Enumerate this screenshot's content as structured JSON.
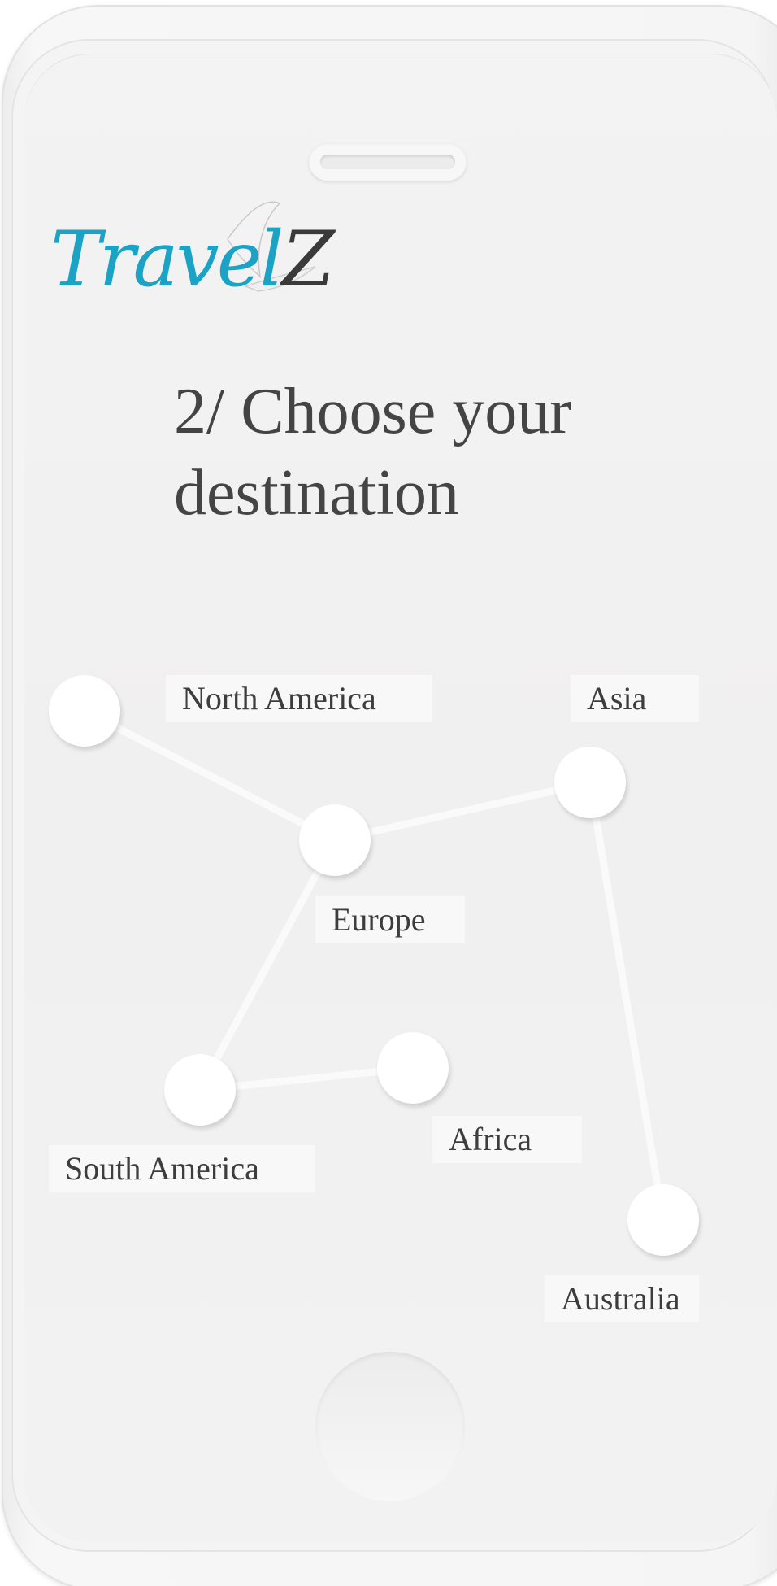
{
  "app": {
    "logo": {
      "text_accent": "Travel",
      "text_dark": "Z"
    },
    "title_line1": "2/ Choose your",
    "title_line2": "destination"
  },
  "destinations": {
    "north_america": "North America",
    "asia": "Asia",
    "europe": "Europe",
    "south_america": "South America",
    "africa": "Africa",
    "australia": "Australia"
  },
  "colors": {
    "brand_accent": "#1ba3c6",
    "text_dark": "#444444",
    "screen_background": "#f2f1f1",
    "node_fill": "#ffffff",
    "link_stroke": "#fafafa"
  }
}
